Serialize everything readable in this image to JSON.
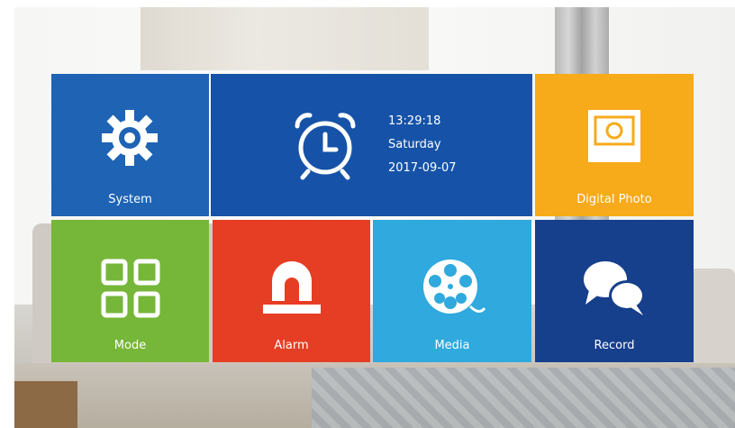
{
  "tiles": {
    "system": {
      "label": "System",
      "icon": "gear-icon",
      "color": "#1e63b4"
    },
    "clock": {
      "icon": "alarm-clock-icon",
      "time": "13:29:18",
      "day": "Saturday",
      "date": "2017-09-07",
      "color": "#1653a8"
    },
    "digital_photo": {
      "label": "Digital Photo",
      "icon": "photo-icon",
      "color": "#f7aa1a"
    },
    "mode": {
      "label": "Mode",
      "icon": "grid-icon",
      "color": "#76b638"
    },
    "alarm": {
      "label": "Alarm",
      "icon": "siren-icon",
      "color": "#e63e24"
    },
    "media": {
      "label": "Media",
      "icon": "film-reel-icon",
      "color": "#2fa9de"
    },
    "record": {
      "label": "Record",
      "icon": "chat-bubbles-icon",
      "color": "#163f8c"
    }
  }
}
